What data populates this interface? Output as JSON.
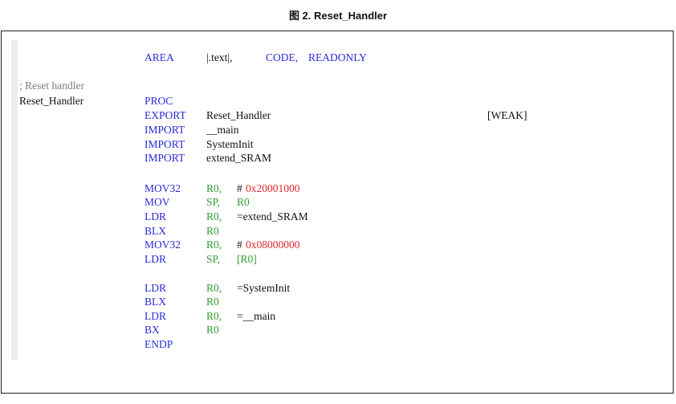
{
  "caption": "图 2. Reset_Handler",
  "code": {
    "area": {
      "mnemonic": "AREA",
      "section": "|.text|,",
      "attr_code": "CODE,",
      "attr_readonly": "READONLY"
    },
    "comment": "; Reset handler",
    "label": "Reset_Handler",
    "proc": "PROC",
    "export": {
      "mnemonic": "EXPORT",
      "symbol": "Reset_Handler",
      "attribute": "[WEAK]"
    },
    "imports": [
      {
        "mnemonic": "IMPORT",
        "symbol": "__main"
      },
      {
        "mnemonic": "IMPORT",
        "symbol": "SystemInit"
      },
      {
        "mnemonic": "IMPORT",
        "symbol": "extend_SRAM"
      }
    ],
    "block1": [
      {
        "mnemonic": "MOV32",
        "reg": "R0,",
        "imm_prefix": "#",
        "imm_value": "0x20001000"
      },
      {
        "mnemonic": "MOV",
        "reg": "SP,",
        "reg2": "R0"
      },
      {
        "mnemonic": "LDR",
        "reg": "R0,",
        "text": "=extend_SRAM"
      },
      {
        "mnemonic": "BLX",
        "reg": "R0"
      },
      {
        "mnemonic": "MOV32",
        "reg": "R0,",
        "imm_prefix": "#",
        "imm_value": "0x08000000"
      },
      {
        "mnemonic": "LDR",
        "reg": "SP,",
        "mem": "[R0]"
      }
    ],
    "block2": [
      {
        "mnemonic": "LDR",
        "reg": "R0,",
        "text": "=SystemInit"
      },
      {
        "mnemonic": "BLX",
        "reg": "R0"
      },
      {
        "mnemonic": "LDR",
        "reg": "R0,",
        "text": "=__main"
      },
      {
        "mnemonic": "BX",
        "reg": "R0"
      }
    ],
    "endp": "ENDP"
  }
}
